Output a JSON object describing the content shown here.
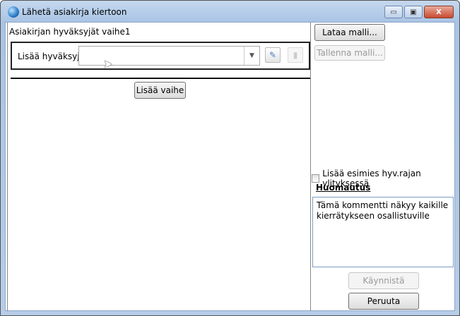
{
  "window": {
    "title": "Lähetä asiakirja kiertoon",
    "minimize": "▭",
    "maximize": "▣",
    "close": "X"
  },
  "stage": {
    "title": "Asiakirjan hyväksyjät vaihe1",
    "approver_label": "Lisää hyväksyjä",
    "approver_value": "",
    "add_stage": "Lisää vaihe"
  },
  "side": {
    "load_template": "Lataa malli...",
    "save_template": "Tallenna malli...",
    "supervisor_checkbox": "Lisää esimies hyv.rajan ylityksessä",
    "supervisor_checked": false,
    "note_heading": "Huomautus",
    "note_text": "Tämä kommentti näkyy kaikille kierrätykseen osallistuville",
    "start": "Käynnistä",
    "cancel": "Peruuta"
  }
}
